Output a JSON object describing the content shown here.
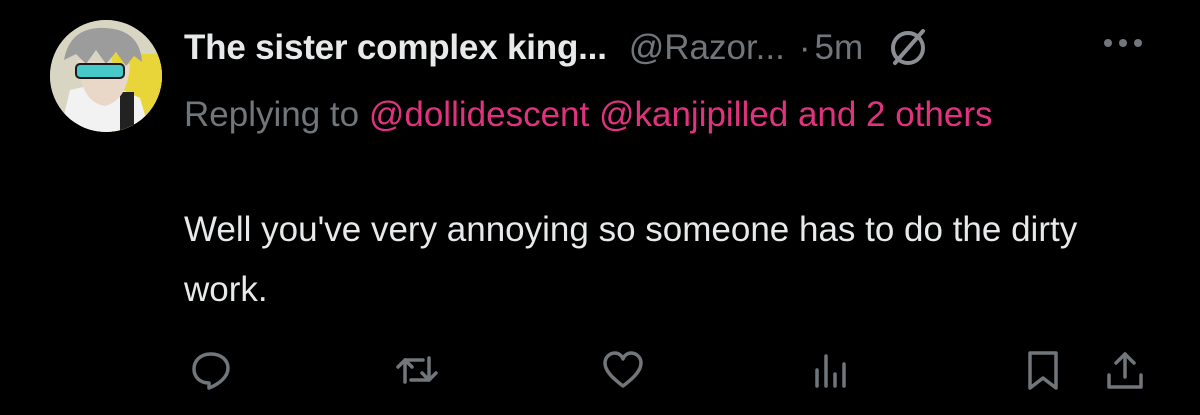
{
  "tweet": {
    "display_name": "The sister complex king...",
    "handle": "@Razor...",
    "separator": "·",
    "time": "5m",
    "reply": {
      "prefix": "Replying to",
      "mention_1": "@dollidescent",
      "mention_2": "@kanjipilled",
      "suffix": "and 2 others"
    },
    "text": "Well you've very annoying so someone has to do the dirty work."
  },
  "icons": {
    "badge": "verified-badge-icon",
    "more": "more-options-icon",
    "reply": "reply-icon",
    "retweet": "retweet-icon",
    "like": "heart-icon",
    "views": "analytics-icon",
    "bookmark": "bookmark-icon",
    "share": "share-icon"
  },
  "colors": {
    "background": "#000000",
    "primary_text": "#e7e9ea",
    "secondary_text": "#71767b",
    "mention": "#e0337f"
  }
}
